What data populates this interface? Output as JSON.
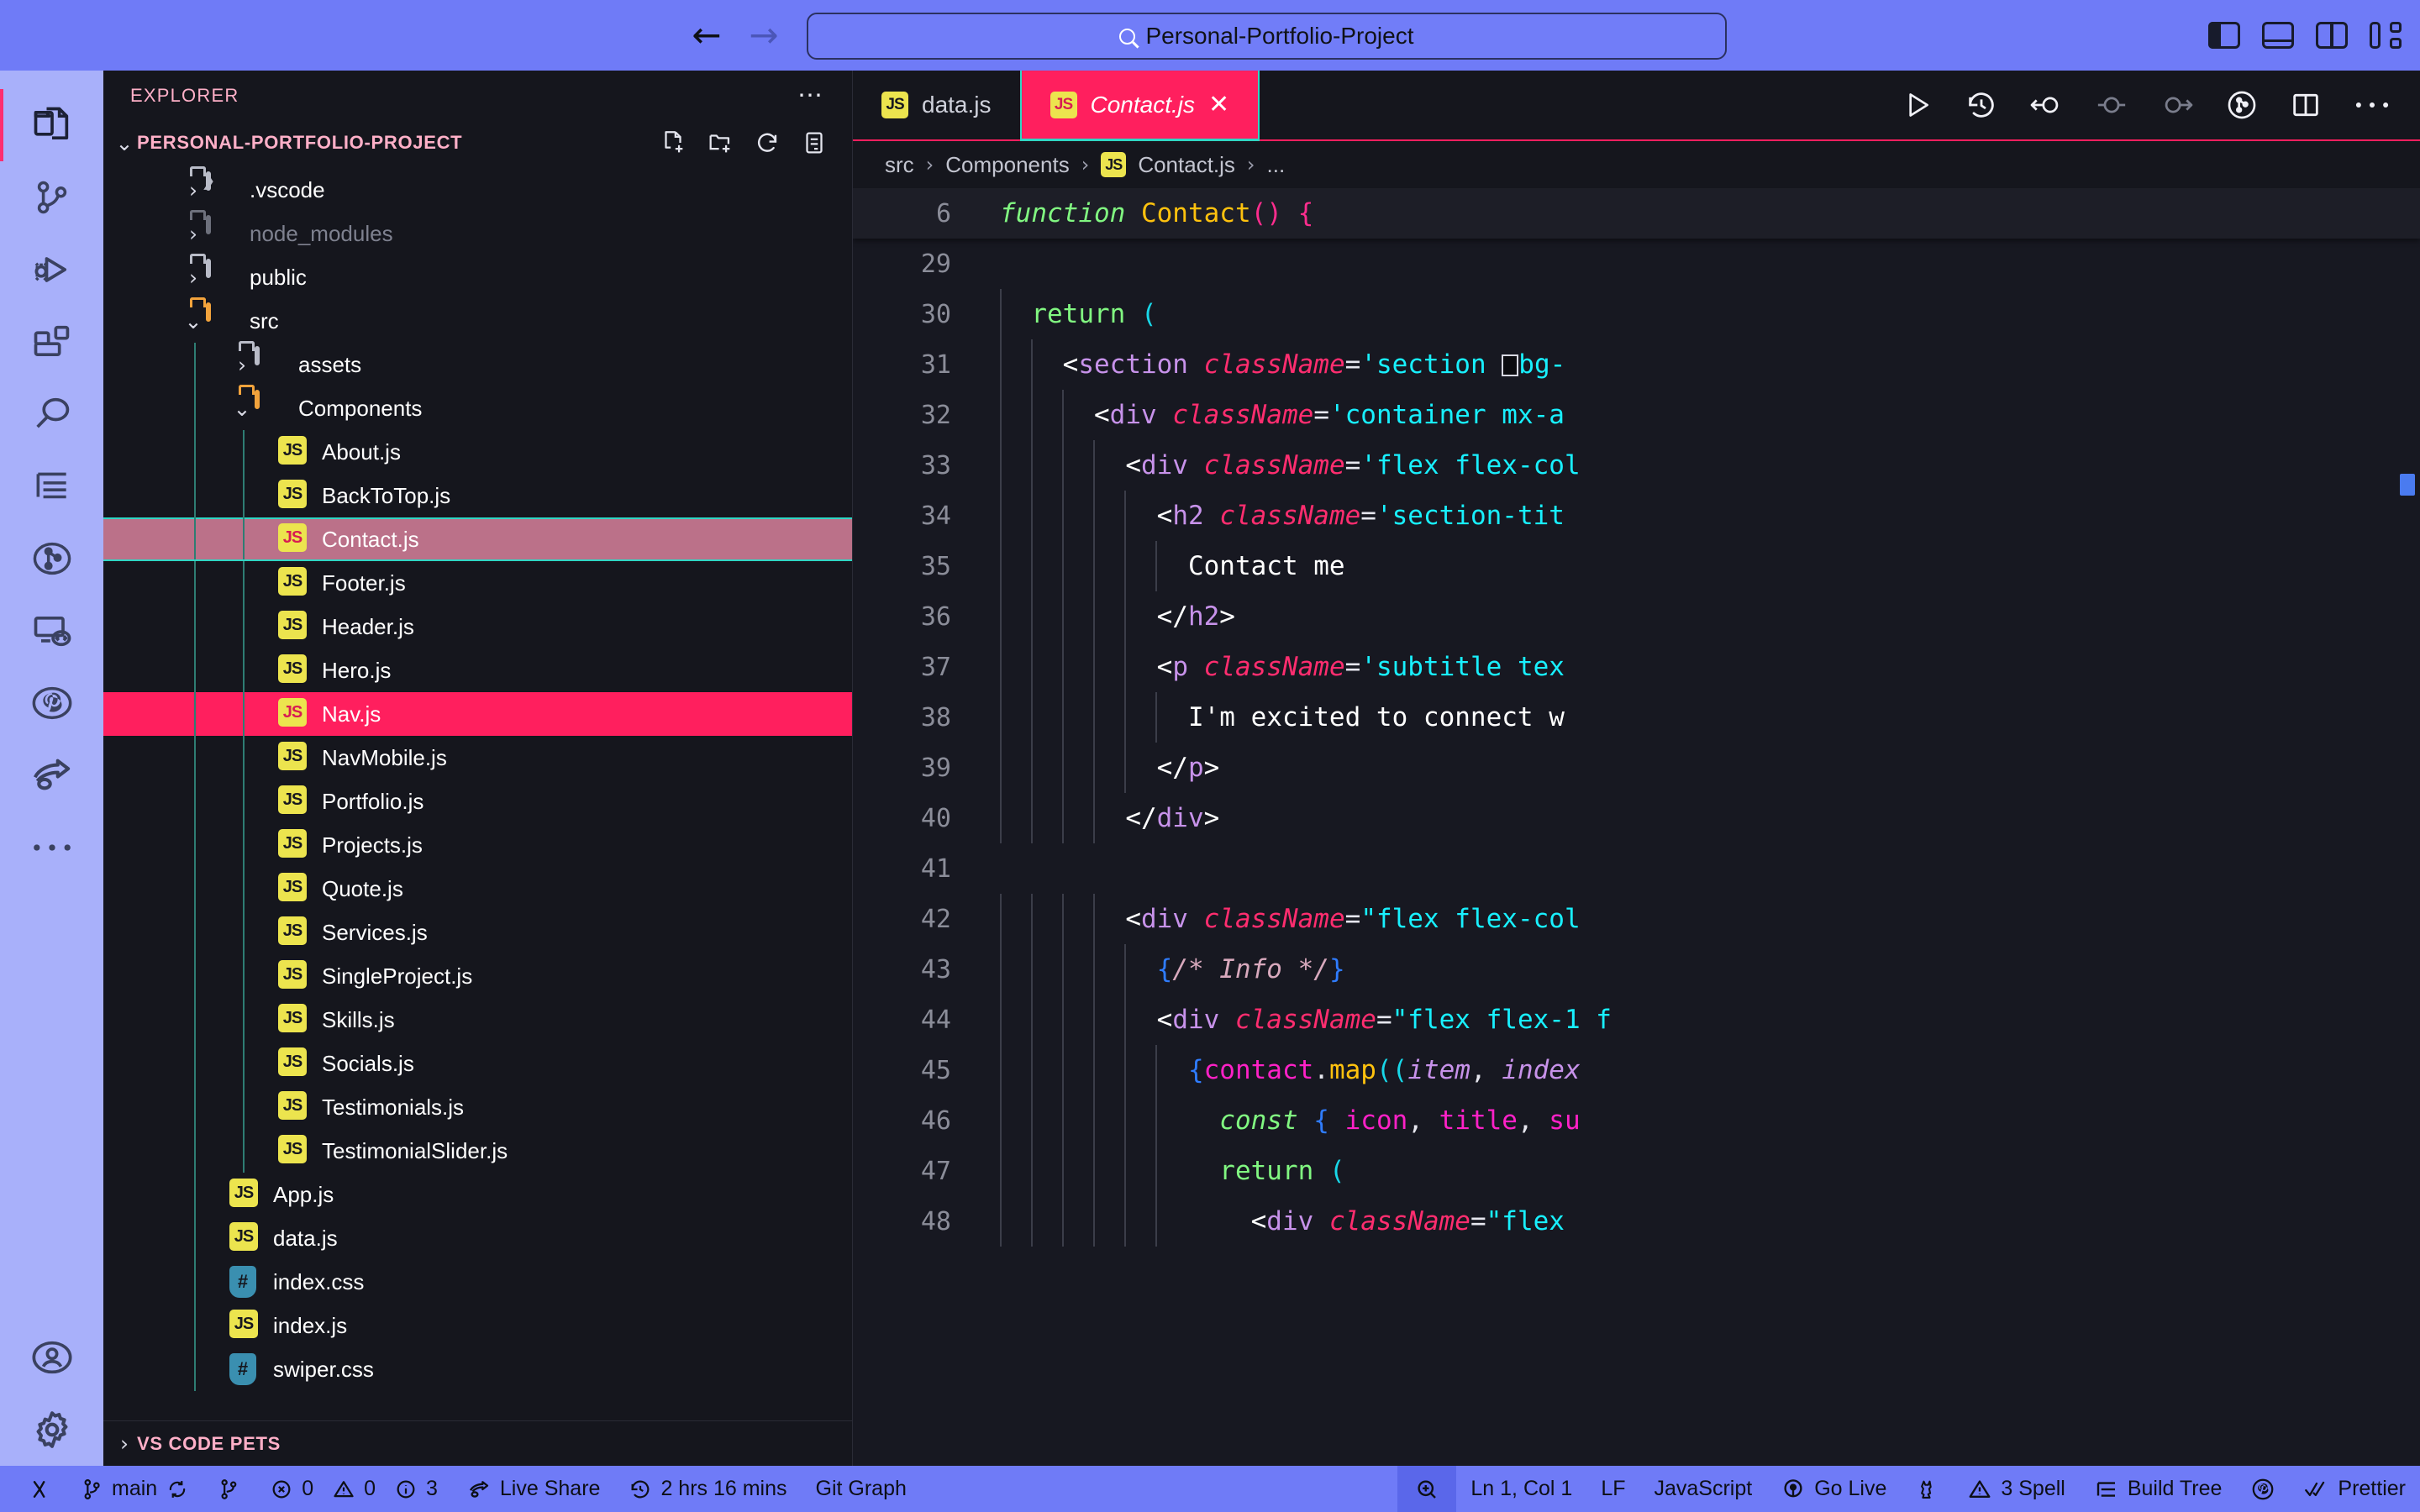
{
  "titlebar": {
    "back_icon": "arrow-left-icon",
    "forward_icon": "arrow-right-icon",
    "search_value": "Personal-Portfolio-Project",
    "search_icon": "search-icon",
    "layout_icons": [
      "toggle-primary-sidebar-icon",
      "toggle-panel-icon",
      "toggle-secondary-sidebar-icon",
      "customize-layout-icon"
    ]
  },
  "activitybar": {
    "items": [
      {
        "name": "explorer",
        "icon": "files-icon",
        "active": true
      },
      {
        "name": "source-control",
        "icon": "source-control-icon",
        "active": false
      },
      {
        "name": "run-and-debug",
        "icon": "run-debug-icon",
        "active": false
      },
      {
        "name": "extensions",
        "icon": "extensions-icon",
        "active": false
      },
      {
        "name": "search",
        "icon": "search-icon",
        "active": false
      },
      {
        "name": "outline",
        "icon": "list-tree-icon",
        "active": false
      },
      {
        "name": "git-graph",
        "icon": "git-graph-circle-icon",
        "active": false
      },
      {
        "name": "remote-explorer",
        "icon": "remote-monitor-icon",
        "active": false
      },
      {
        "name": "github",
        "icon": "github-icon",
        "active": false
      },
      {
        "name": "live-share",
        "icon": "live-share-icon",
        "active": false
      },
      {
        "name": "more",
        "icon": "ellipsis-icon",
        "active": false
      }
    ],
    "bottom": [
      {
        "name": "accounts",
        "icon": "account-icon"
      },
      {
        "name": "settings",
        "icon": "gear-icon"
      }
    ]
  },
  "sidebar": {
    "title": "EXPLORER",
    "more_icon": "ellipsis-icon",
    "root": {
      "name": "PERSONAL-PORTFOLIO-PROJECT",
      "expanded": true,
      "actions": [
        "new-file-icon",
        "new-folder-icon",
        "refresh-icon",
        "collapse-all-icon"
      ]
    },
    "tree": [
      {
        "label": ".vscode",
        "type": "folder",
        "variant": "vscode",
        "depth": 1,
        "expanded": false
      },
      {
        "label": "node_modules",
        "type": "folder",
        "variant": "dimmed",
        "depth": 1,
        "expanded": false,
        "dim": true
      },
      {
        "label": "public",
        "type": "folder",
        "variant": "closed",
        "depth": 1,
        "expanded": false
      },
      {
        "label": "src",
        "type": "folder",
        "variant": "open",
        "depth": 1,
        "expanded": true
      },
      {
        "label": "assets",
        "type": "folder",
        "variant": "closed",
        "depth": 2,
        "expanded": false
      },
      {
        "label": "Components",
        "type": "folder",
        "variant": "open",
        "depth": 2,
        "expanded": true
      },
      {
        "label": "About.js",
        "type": "js",
        "depth": 3
      },
      {
        "label": "BackToTop.js",
        "type": "js",
        "depth": 3
      },
      {
        "label": "Contact.js",
        "type": "js",
        "depth": 3,
        "state": "selected"
      },
      {
        "label": "Footer.js",
        "type": "js",
        "depth": 3
      },
      {
        "label": "Header.js",
        "type": "js",
        "depth": 3
      },
      {
        "label": "Hero.js",
        "type": "js",
        "depth": 3
      },
      {
        "label": "Nav.js",
        "type": "js",
        "depth": 3,
        "state": "hovered"
      },
      {
        "label": "NavMobile.js",
        "type": "js",
        "depth": 3
      },
      {
        "label": "Portfolio.js",
        "type": "js",
        "depth": 3
      },
      {
        "label": "Projects.js",
        "type": "js",
        "depth": 3
      },
      {
        "label": "Quote.js",
        "type": "js",
        "depth": 3
      },
      {
        "label": "Services.js",
        "type": "js",
        "depth": 3
      },
      {
        "label": "SingleProject.js",
        "type": "js",
        "depth": 3
      },
      {
        "label": "Skills.js",
        "type": "js",
        "depth": 3
      },
      {
        "label": "Socials.js",
        "type": "js",
        "depth": 3
      },
      {
        "label": "Testimonials.js",
        "type": "js",
        "depth": 3
      },
      {
        "label": "TestimonialSlider.js",
        "type": "js",
        "depth": 3
      },
      {
        "label": "App.js",
        "type": "js",
        "depth": 2
      },
      {
        "label": "data.js",
        "type": "js",
        "depth": 2
      },
      {
        "label": "index.css",
        "type": "css",
        "depth": 2
      },
      {
        "label": "index.js",
        "type": "js",
        "depth": 2
      },
      {
        "label": "swiper.css",
        "type": "css",
        "depth": 2
      }
    ],
    "bottom_panel": {
      "label": "VS CODE PETS",
      "expanded": false
    }
  },
  "editor": {
    "tabs": [
      {
        "label": "data.js",
        "icon": "js-file-icon",
        "active": false
      },
      {
        "label": "Contact.js",
        "icon": "js-file-icon",
        "active": true,
        "close_icon": "close-icon"
      }
    ],
    "actions": [
      "run-icon",
      "timeline-history-icon",
      "go-back-icon",
      "circle-icon",
      "circle-arrow-right-icon",
      "git-graph-icon",
      "split-editor-icon",
      "more-actions-icon"
    ],
    "breadcrumb": [
      "src",
      "Components",
      "Contact.js",
      "..."
    ],
    "breadcrumb_file_icon": "js-file-icon",
    "sticky_line": {
      "number": "6",
      "text": "function Contact() {"
    },
    "lines": [
      {
        "number": "29",
        "text": ""
      },
      {
        "number": "30",
        "text": "  return ("
      },
      {
        "number": "31",
        "text": "    <section className='section □bg-"
      },
      {
        "number": "32",
        "text": "      <div className='container mx-a"
      },
      {
        "number": "33",
        "text": "        <div className='flex flex-col "
      },
      {
        "number": "34",
        "text": "          <h2 className='section-tit"
      },
      {
        "number": "35",
        "text": "            Contact me"
      },
      {
        "number": "36",
        "text": "          </h2>"
      },
      {
        "number": "37",
        "text": "          <p className='subtitle tex"
      },
      {
        "number": "38",
        "text": "            I'm excited to connect w"
      },
      {
        "number": "39",
        "text": "          </p>"
      },
      {
        "number": "40",
        "text": "        </div>"
      },
      {
        "number": "41",
        "text": ""
      },
      {
        "number": "42",
        "text": "        <div className=\"flex flex-col "
      },
      {
        "number": "43",
        "text": "          {/* Info */}"
      },
      {
        "number": "44",
        "text": "          <div className=\"flex flex-1 f"
      },
      {
        "number": "45",
        "text": "            {contact.map((item, index"
      },
      {
        "number": "46",
        "text": "              const { icon, title, su"
      },
      {
        "number": "47",
        "text": "              return ("
      },
      {
        "number": "48",
        "text": "                <div className=\"flex "
      }
    ]
  },
  "statusbar": {
    "left": [
      {
        "name": "remote-host",
        "icon": "remote-icon",
        "label": ""
      },
      {
        "name": "branch",
        "icon": "branch-icon",
        "label": "main",
        "sync_icon": "sync-icon"
      },
      {
        "name": "git-compare",
        "icon": "git-compare-icon",
        "label": ""
      },
      {
        "name": "problems",
        "error_icon": "error-icon",
        "errors": "0",
        "warning_icon": "warning-icon",
        "warnings": "0",
        "info_icon": "info-icon",
        "infos": "3"
      },
      {
        "name": "live-share",
        "icon": "live-share-icon",
        "label": "Live Share"
      },
      {
        "name": "time-tracker",
        "icon": "clock-icon",
        "label": "2 hrs 16 mins"
      },
      {
        "name": "git-graph",
        "label": "Git Graph"
      }
    ],
    "right": [
      {
        "name": "zoom",
        "icon": "zoom-icon",
        "label": ""
      },
      {
        "name": "cursor-position",
        "label": "Ln 1, Col 1"
      },
      {
        "name": "line-endings",
        "label": "LF"
      },
      {
        "name": "language-mode",
        "label": "JavaScript"
      },
      {
        "name": "go-live",
        "icon": "broadcast-icon",
        "label": "Go Live"
      },
      {
        "name": "cat-pet",
        "icon": "cat-icon",
        "label": ""
      },
      {
        "name": "spell-checker",
        "icon": "warning-icon",
        "label": "3 Spell"
      },
      {
        "name": "build-tree",
        "icon": "tree-icon",
        "label": "Build Tree"
      },
      {
        "name": "github-status",
        "icon": "github-icon",
        "label": ""
      },
      {
        "name": "prettier",
        "icon": "check-icon",
        "label": "Prettier"
      }
    ]
  },
  "colors": {
    "accent_blue": "#6f7bf7",
    "accent_pink": "#ff1f5e",
    "accent_cyan": "#2fd6c3",
    "editor_bg": "#171821",
    "sidebar_bg": "#15161d",
    "activitybar_bg": "#a8b0fa",
    "selected_row": "#bb7189"
  }
}
